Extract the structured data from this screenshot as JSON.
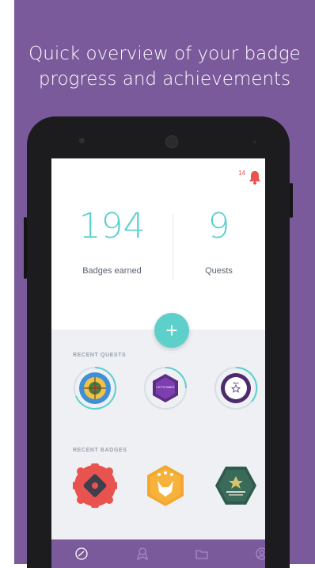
{
  "headline": {
    "line1": "Quick overview of your badge",
    "line2": "progress and achievements"
  },
  "notifications": {
    "count": "14",
    "icon": "bell-icon"
  },
  "stats": [
    {
      "value": "194",
      "label": "Badges earned"
    },
    {
      "value": "9",
      "label": "Quests"
    }
  ],
  "fab": {
    "label": "+"
  },
  "recent_quests": {
    "title": "RECENT QUESTS",
    "items": [
      {
        "icon": "target-badge-icon"
      },
      {
        "icon": "hexagon-badge-icon",
        "text": "LET'S MAKE"
      },
      {
        "icon": "circle-star-badge-icon",
        "text": "IBM"
      }
    ]
  },
  "recent_badges": {
    "title": "RECENT BADGES",
    "items": [
      {
        "icon": "red-scalloped-badge-icon"
      },
      {
        "icon": "orange-fox-badge-icon"
      },
      {
        "icon": "green-hexagon-badge-icon"
      }
    ]
  },
  "nav": [
    "dashboard-icon",
    "badges-icon",
    "folder-icon",
    "profile-icon"
  ],
  "colors": {
    "purple": "#7b5a9c",
    "teal": "#5dd0cc",
    "red": "#e8524f"
  }
}
